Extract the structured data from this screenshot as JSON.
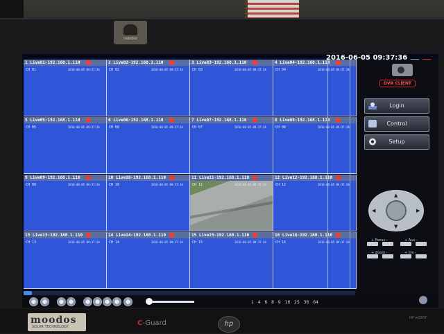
{
  "window": {
    "timestamp": "2016-06-05 09:37:36",
    "dvr_badge": "DVR CLIENT"
  },
  "cameras": [
    {
      "title": "1 Live01-192.168.1.110",
      "ch": "CH 01",
      "datetime": "2016-06-05 09:37:34"
    },
    {
      "title": "2 Live02-192.168.1.110",
      "ch": "CH 02",
      "datetime": "2016-06-05 09:37:34"
    },
    {
      "title": "3 Live03-192.168.1.110",
      "ch": "CH 03",
      "datetime": "2016-06-05 09:37:34"
    },
    {
      "title": "4 Live04-192.168.1.110",
      "ch": "CH 04",
      "datetime": "2016-06-05 09:37:34"
    },
    {
      "title": "5 Live05-192.168.1.110",
      "ch": "CH 05",
      "datetime": "2016-06-05 09:37:34"
    },
    {
      "title": "6 Live06-192.168.1.110",
      "ch": "CH 06",
      "datetime": "2016-06-05 09:37:34"
    },
    {
      "title": "7 Live07-192.168.1.110",
      "ch": "CH 07",
      "datetime": "2016-06-05 09:37:34"
    },
    {
      "title": "8 Live08-192.168.1.110",
      "ch": "CH 08",
      "datetime": "2016-06-05 09:37:34"
    },
    {
      "title": "9 Live09-192.168.1.110",
      "ch": "CH 09",
      "datetime": "2016-06-05 09:37:34"
    },
    {
      "title": "10 Live10-192.168.1.110",
      "ch": "CH 10",
      "datetime": "2016-06-05 09:37:34"
    },
    {
      "title": "11 Live11-192.168.1.110",
      "ch": "CH 11",
      "datetime": "2016-06-05 09:37:34"
    },
    {
      "title": "12 Live12-192.168.1.110",
      "ch": "CH 12",
      "datetime": "2016-06-05 09:37:34"
    },
    {
      "title": "13 Live13-192.168.1.110",
      "ch": "CH 13",
      "datetime": "2016-06-05 09:37:34"
    },
    {
      "title": "14 Live14-192.168.1.110",
      "ch": "CH 14",
      "datetime": "2016-06-05 09:37:34"
    },
    {
      "title": "15 Live15-192.168.1.110",
      "ch": "CH 15",
      "datetime": "2016-06-05 09:37:34"
    },
    {
      "title": "16 Live16-192.168.1.110",
      "ch": "CH 16",
      "datetime": "2016-06-05 09:37:34"
    }
  ],
  "active_video_channel": "CH 11",
  "panel": {
    "login_label": "Login",
    "control_label": "Control",
    "setup_label": "Setup",
    "focus_label": "Focus",
    "aux_label": "Aux",
    "zoom_label": "Zoom",
    "iris_label": "Iris"
  },
  "toolbar": {
    "layout_options": [
      "1",
      "4",
      "6",
      "8",
      "9",
      "16",
      "25",
      "36",
      "64"
    ],
    "progress": 0.025
  },
  "bezel": {
    "brand": "moodos",
    "brand_sub": "SOLAR TECHNOLOGY",
    "cguard": "C-Guard",
    "hp": "hp",
    "model": "HP w2207",
    "top_brand": "moodos"
  },
  "colors": {
    "tile_blue": "#2f56d8",
    "rec_red": "#ff3a2a",
    "accent_red": "#d23"
  },
  "icons": {
    "window_controls": [
      "minimize-icon",
      "close-icon"
    ],
    "panel": [
      "camera-icon",
      "user-icon",
      "monitor-icon",
      "gear-icon",
      "ptz-joystick-icon"
    ]
  }
}
